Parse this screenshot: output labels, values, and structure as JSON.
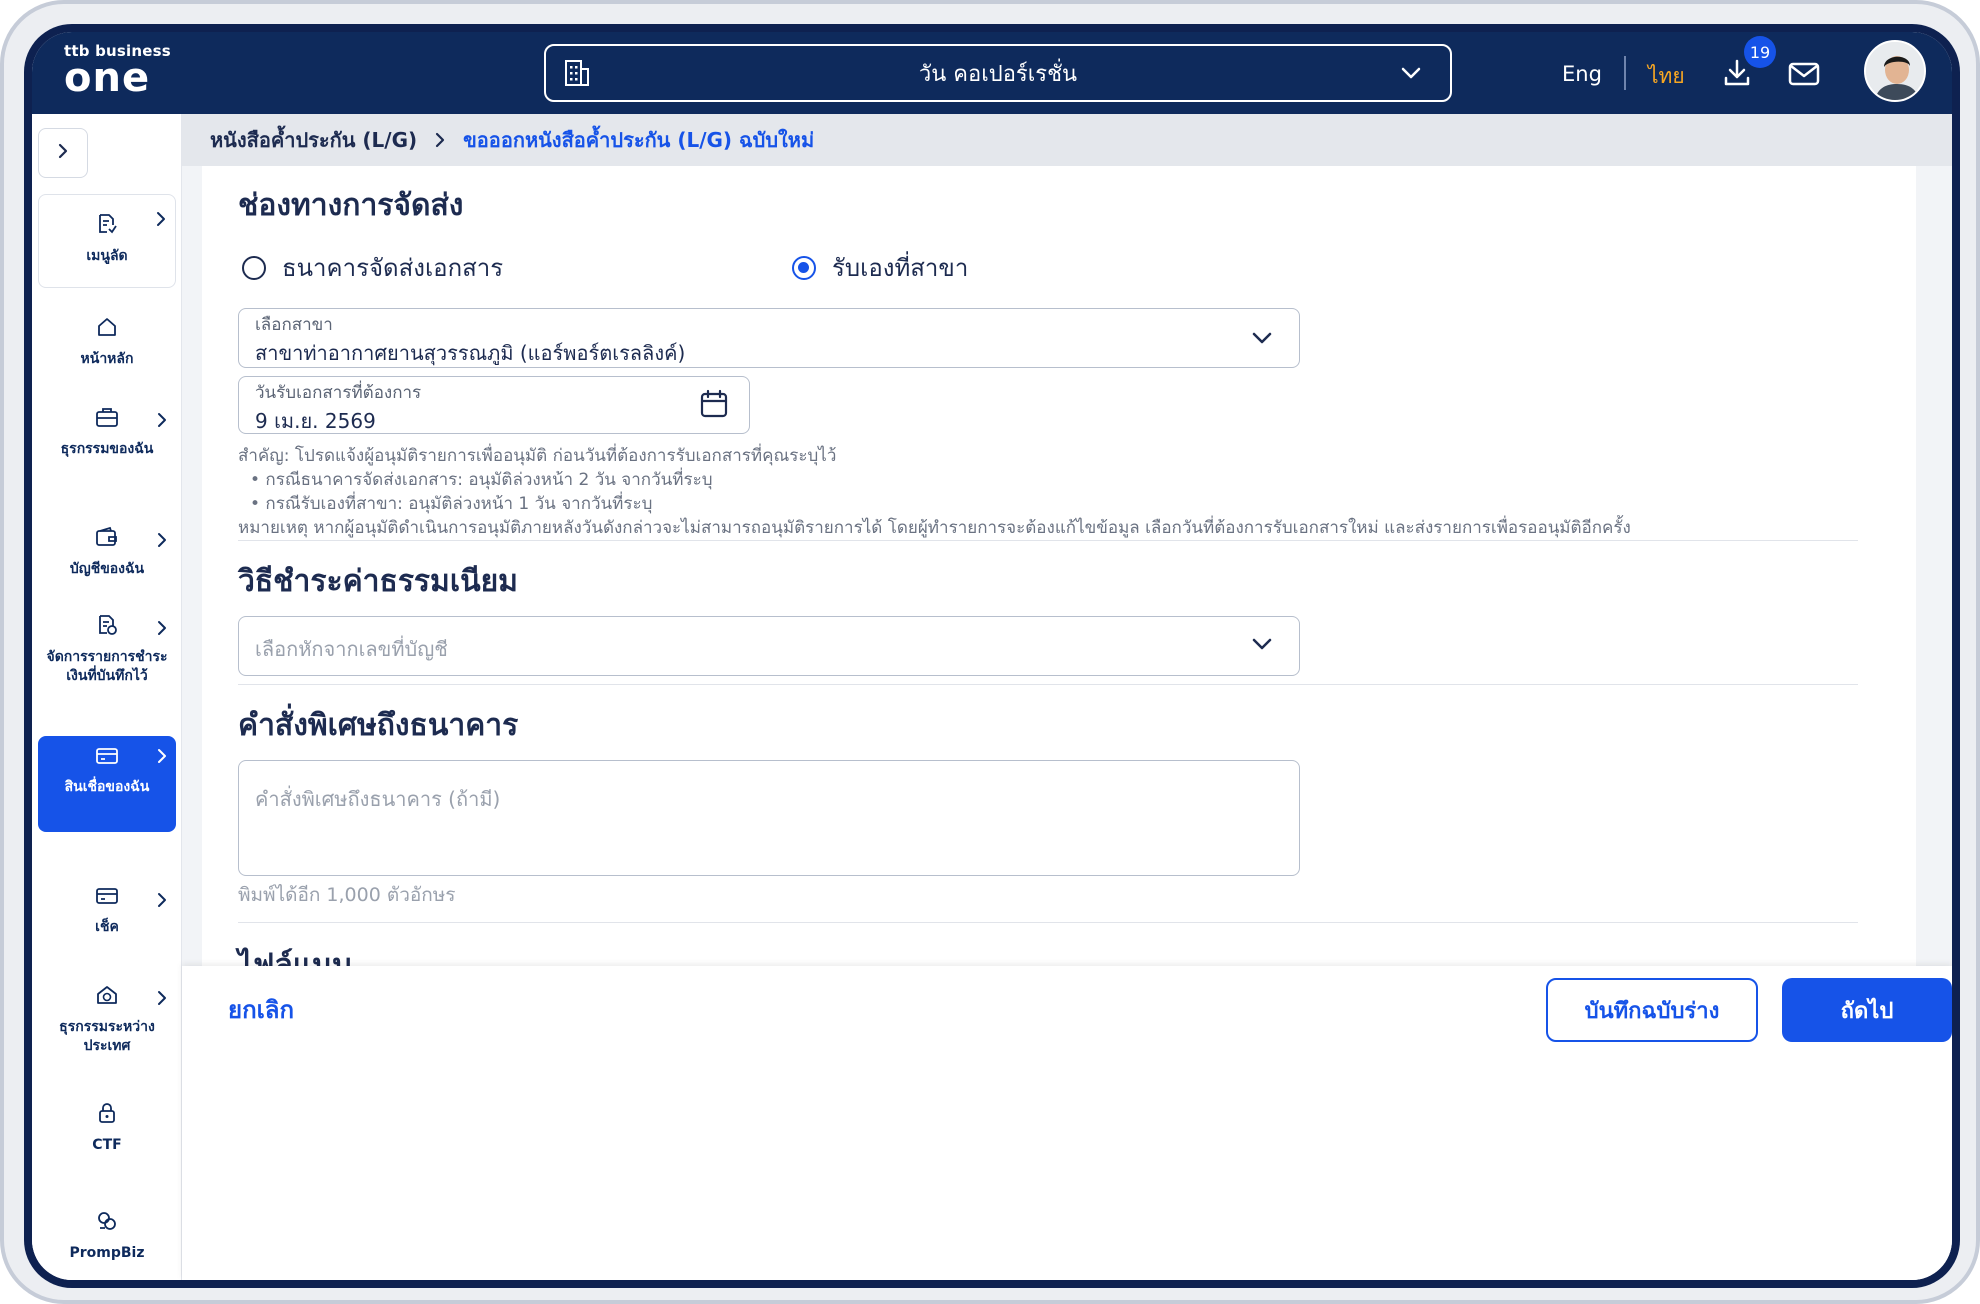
{
  "header": {
    "logo_small": "ttb business",
    "logo_big": "one",
    "company": "วัน คอเปอร์เรชั่น",
    "lang_en": "Eng",
    "lang_th": "ไทย",
    "download_badge": "19"
  },
  "sidebar": {
    "items": [
      {
        "label": "เมนูลัด",
        "icon": "shortcut-icon",
        "has_arrow": true
      },
      {
        "label": "หน้าหลัก",
        "icon": "home-icon",
        "has_arrow": false
      },
      {
        "label": "ธุรกรรมของฉัน",
        "icon": "briefcase-icon",
        "has_arrow": true
      },
      {
        "label": "บัญชีของฉัน",
        "icon": "wallet-icon",
        "has_arrow": true
      },
      {
        "label": "จัดการรายการชำระเงินที่บันทึกไว้",
        "icon": "document-icon",
        "has_arrow": true
      },
      {
        "label": "สินเชื่อของฉัน",
        "icon": "credit-card-icon",
        "has_arrow": true,
        "active": true
      },
      {
        "label": "เช็ค",
        "icon": "cheque-icon",
        "has_arrow": true
      },
      {
        "label": "ธุรกรรมระหว่างประเทศ",
        "icon": "international-icon",
        "has_arrow": true
      },
      {
        "label": "CTF",
        "icon": "lock-icon",
        "has_arrow": false
      },
      {
        "label": "PrompBiz",
        "icon": "prompbiz-icon",
        "has_arrow": false
      }
    ]
  },
  "breadcrumb": {
    "parent": "หนังสือค้ำประกัน (L/G)",
    "current": "ขอออกหนังสือค้ำประกัน (L/G) ฉบับใหม่"
  },
  "delivery": {
    "title": "ช่องทางการจัดส่ง",
    "option_bank": "ธนาคารจัดส่งเอกสาร",
    "option_branch": "รับเองที่สาขา",
    "selected": "branch",
    "branch_label": "เลือกสาขา",
    "branch_value": "สาขาท่าอากาศยานสุวรรณภูมิ (แอร์พอร์ตเรลลิงค์)",
    "date_label": "วันรับเอกสารที่ต้องการ",
    "date_value": "9 เม.ย. 2569",
    "note_line1": "สำคัญ: โปรดแจ้งผู้อนุมัติรายการเพื่ออนุมัติ ก่อนวันที่ต้องการรับเอกสารที่คุณระบุไว้",
    "note_bullet1": "• กรณีธนาคารจัดส่งเอกสาร: อนุมัติล่วงหน้า 2 วัน จากวันที่ระบุ",
    "note_bullet2": "• กรณีรับเองที่สาขา: อนุมัติล่วงหน้า 1 วัน จากวันที่ระบุ",
    "note_line2": "หมายเหตุ หากผู้อนุมัติดำเนินการอนุมัติภายหลังวันดังกล่าวจะไม่สามารถอนุมัติรายการได้ โดยผู้ทำรายการจะต้องแก้ไขข้อมูล เลือกวันที่ต้องการรับเอกสารใหม่ และส่งรายการเพื่อรออนุมัติอีกครั้ง"
  },
  "fee": {
    "title": "วิธีชำระค่าธรรมเนียม",
    "account_placeholder": "เลือกหักจากเลขที่บัญชี"
  },
  "instruction": {
    "title": "คำสั่งพิเศษถึงธนาคาร",
    "placeholder": "คำสั่งพิเศษถึงธนาคาร (ถ้ามี)",
    "counter": "พิมพ์ได้อีก 1,000 ตัวอักษร"
  },
  "attachment": {
    "title": "ไฟล์แนบ"
  },
  "footer": {
    "cancel": "ยกเลิก",
    "save_draft": "บันทึกฉบับร่าง",
    "next": "ถัดไป"
  },
  "colors": {
    "navy": "#0e2a5c",
    "primary": "#1653e8",
    "accent_lang": "#f6a623"
  }
}
